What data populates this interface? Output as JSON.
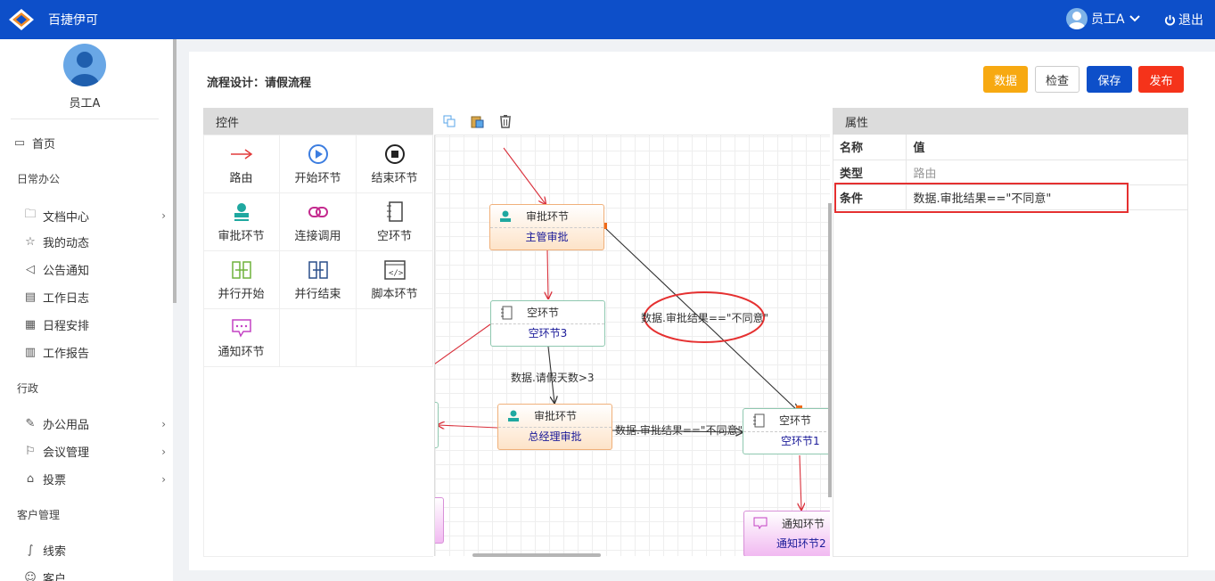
{
  "header": {
    "app_title": "百捷伊可",
    "user_name": "员工A",
    "logout_label": "退出",
    "brand_color": "#0d4fc9"
  },
  "sidebar": {
    "user_name": "员工A",
    "home": "首页",
    "groups": {
      "daily": "日常办公",
      "admin": "行政",
      "crm": "客户管理"
    },
    "items": [
      {
        "label": "文档中心",
        "icon": "folder-icon"
      },
      {
        "label": "我的动态",
        "icon": "star-icon"
      },
      {
        "label": "公告通知",
        "icon": "speaker-icon"
      },
      {
        "label": "工作日志",
        "icon": "log-icon"
      },
      {
        "label": "日程安排",
        "icon": "calendar-icon"
      },
      {
        "label": "工作报告",
        "icon": "report-icon"
      },
      {
        "label": "办公用品",
        "icon": "edit-icon"
      },
      {
        "label": "会议管理",
        "icon": "meeting-icon"
      },
      {
        "label": "投票",
        "icon": "vote-icon"
      },
      {
        "label": "线索",
        "icon": "clue-icon"
      },
      {
        "label": "客户",
        "icon": "customer-icon"
      }
    ]
  },
  "page": {
    "title": "流程设计：请假流程",
    "buttons": {
      "data": "数据",
      "check": "检查",
      "save": "保存",
      "publish": "发布"
    }
  },
  "controls": {
    "title": "控件",
    "items": [
      {
        "label": "路由",
        "icon": "route-arrow-icon"
      },
      {
        "label": "开始环节",
        "icon": "start-play-icon"
      },
      {
        "label": "结束环节",
        "icon": "end-stop-icon"
      },
      {
        "label": "审批环节",
        "icon": "approve-stamp-icon"
      },
      {
        "label": "连接调用",
        "icon": "link-icon"
      },
      {
        "label": "空环节",
        "icon": "empty-notebook-icon"
      },
      {
        "label": "并行开始",
        "icon": "parallel-start-icon"
      },
      {
        "label": "并行结束",
        "icon": "parallel-end-icon"
      },
      {
        "label": "脚本环节",
        "icon": "script-icon"
      },
      {
        "label": "通知环节",
        "icon": "notify-icon"
      }
    ]
  },
  "canvas": {
    "nodes": {
      "manager": {
        "type": "审批环节",
        "name": "主管审批"
      },
      "empty3": {
        "type": "空环节",
        "name": "空环节3"
      },
      "gm": {
        "type": "审批环节",
        "name": "总经理审批"
      },
      "empty1": {
        "type": "空环节",
        "name": "空环节1"
      },
      "notify2": {
        "type": "通知环节",
        "name": "通知环节2"
      }
    },
    "edge_labels": {
      "reject_manager": "数据.审批结果==\"不同意\"",
      "days": "数据.请假天数>3",
      "reject_gm": "数据.审批结果==\"不同意\""
    }
  },
  "properties": {
    "title": "属性",
    "headers": {
      "name": "名称",
      "value": "值"
    },
    "rows": [
      {
        "name": "类型",
        "value": "路由"
      },
      {
        "name": "条件",
        "value": "数据.审批结果==\"不同意\""
      }
    ]
  }
}
